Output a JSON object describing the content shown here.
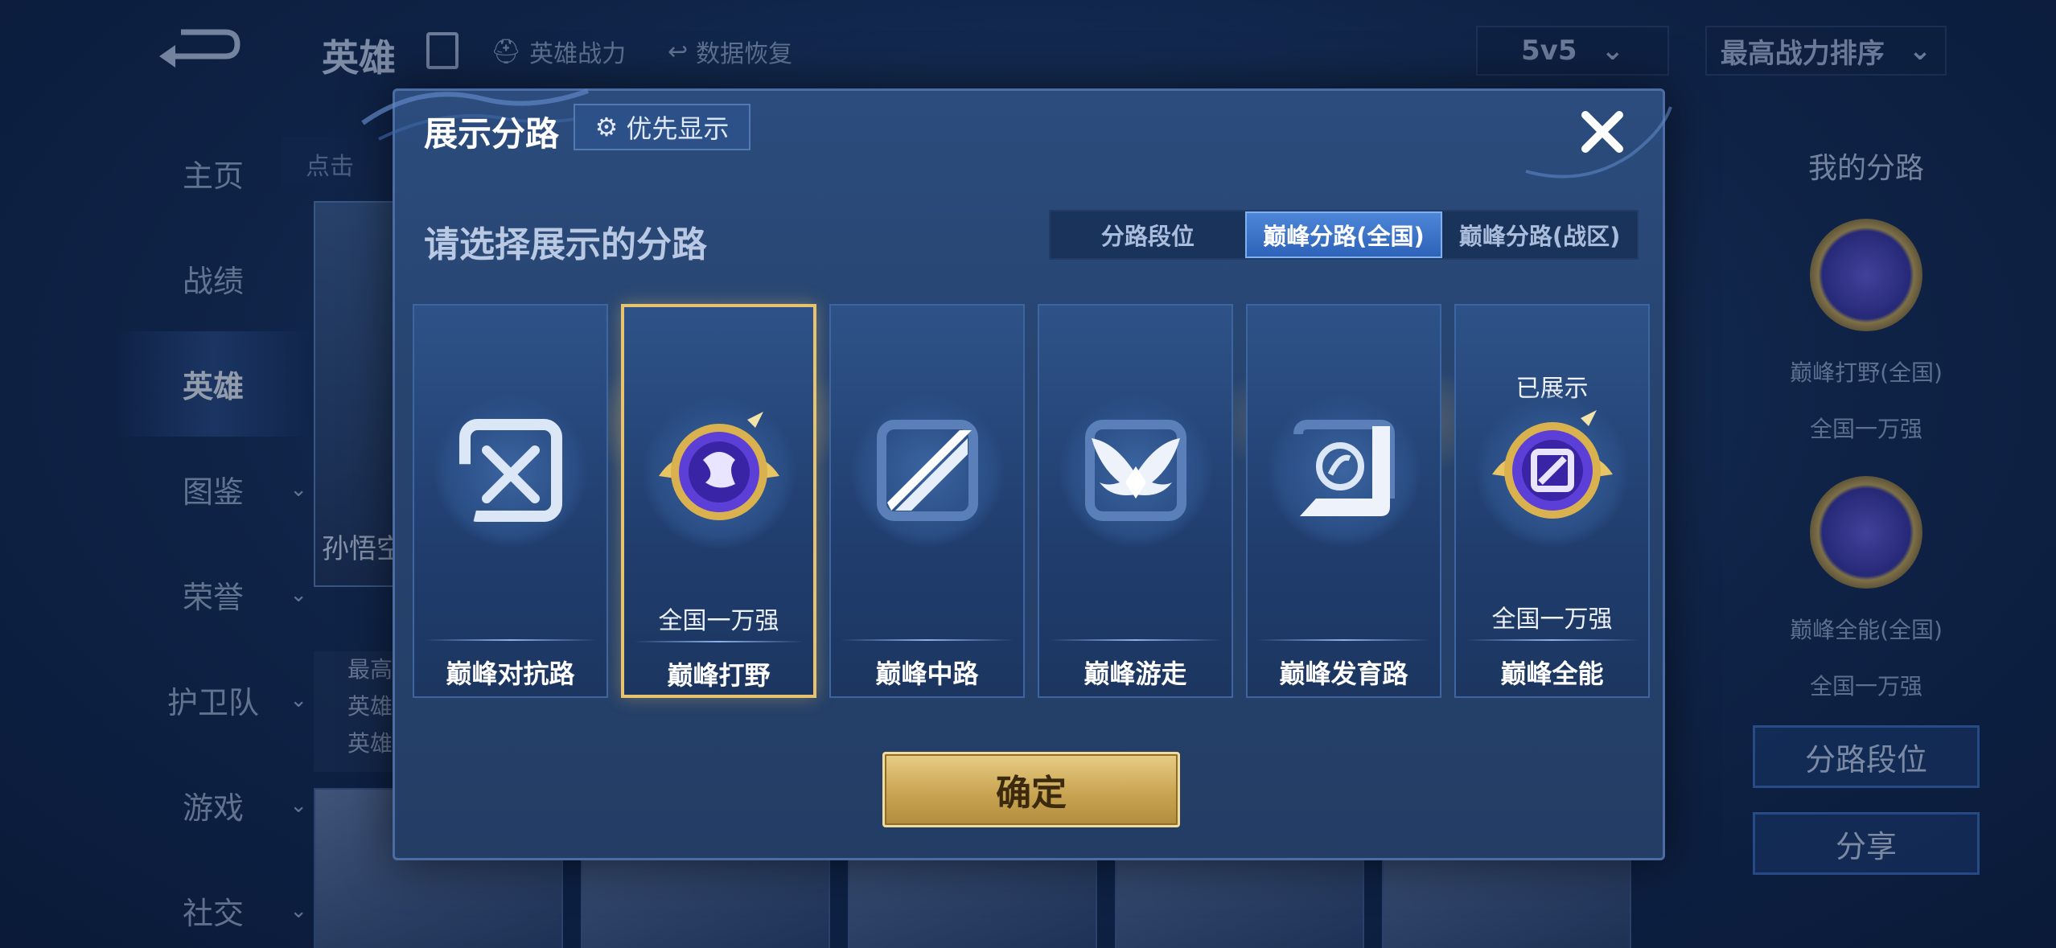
{
  "background": {
    "topbar": {
      "title": "英雄",
      "power_label": "英雄战力",
      "restore_label": "数据恢复",
      "mode_value": "5v5",
      "sort_value": "最高战力排序"
    },
    "sidebar": {
      "items": [
        {
          "label": "主页",
          "has_arrow": false
        },
        {
          "label": "战绩",
          "has_arrow": false
        },
        {
          "label": "英雄",
          "has_arrow": false,
          "active": true
        },
        {
          "label": "图鉴",
          "has_arrow": true
        },
        {
          "label": "荣誉",
          "has_arrow": true
        },
        {
          "label": "护卫队",
          "has_arrow": true
        },
        {
          "label": "游戏",
          "has_arrow": true
        },
        {
          "label": "社交",
          "has_arrow": true
        }
      ]
    },
    "search_placeholder": "点击",
    "hero_name": "孙悟空",
    "hero_info": [
      "最高",
      "英雄",
      "英雄"
    ],
    "right_panel": {
      "title": "我的分路",
      "lane1_label": "巅峰打野(全国)",
      "lane1_rank": "全国一万强",
      "lane2_label": "巅峰全能(全国)",
      "lane2_rank": "全国一万强",
      "lane_rank_button": "分路段位",
      "share_button": "分享"
    }
  },
  "modal": {
    "title": "展示分路",
    "priority_button": "优先显示",
    "prompt": "请选择展示的分路",
    "tabs": [
      "分路段位",
      "巅峰分路(全国)",
      "巅峰分路(战区)"
    ],
    "active_tab": 1,
    "cards": [
      {
        "name": "巅峰对抗路",
        "rank": "",
        "status": "",
        "icon": "clash-lane-icon",
        "selected": false
      },
      {
        "name": "巅峰打野",
        "rank": "全国一万强",
        "status": "",
        "icon": "jungle-medal-icon",
        "selected": true
      },
      {
        "name": "巅峰中路",
        "rank": "",
        "status": "",
        "icon": "mid-lane-icon",
        "selected": false
      },
      {
        "name": "巅峰游走",
        "rank": "",
        "status": "",
        "icon": "roam-icon",
        "selected": false
      },
      {
        "name": "巅峰发育路",
        "rank": "",
        "status": "",
        "icon": "farm-lane-icon",
        "selected": false
      },
      {
        "name": "巅峰全能",
        "rank": "全国一万强",
        "status": "已展示",
        "icon": "all-round-medal-icon",
        "selected": false
      }
    ],
    "confirm_button": "确定",
    "colors": {
      "accent_gold": "#e7c36f",
      "tab_active": "#3b74c9",
      "panel": "#27446f"
    }
  }
}
